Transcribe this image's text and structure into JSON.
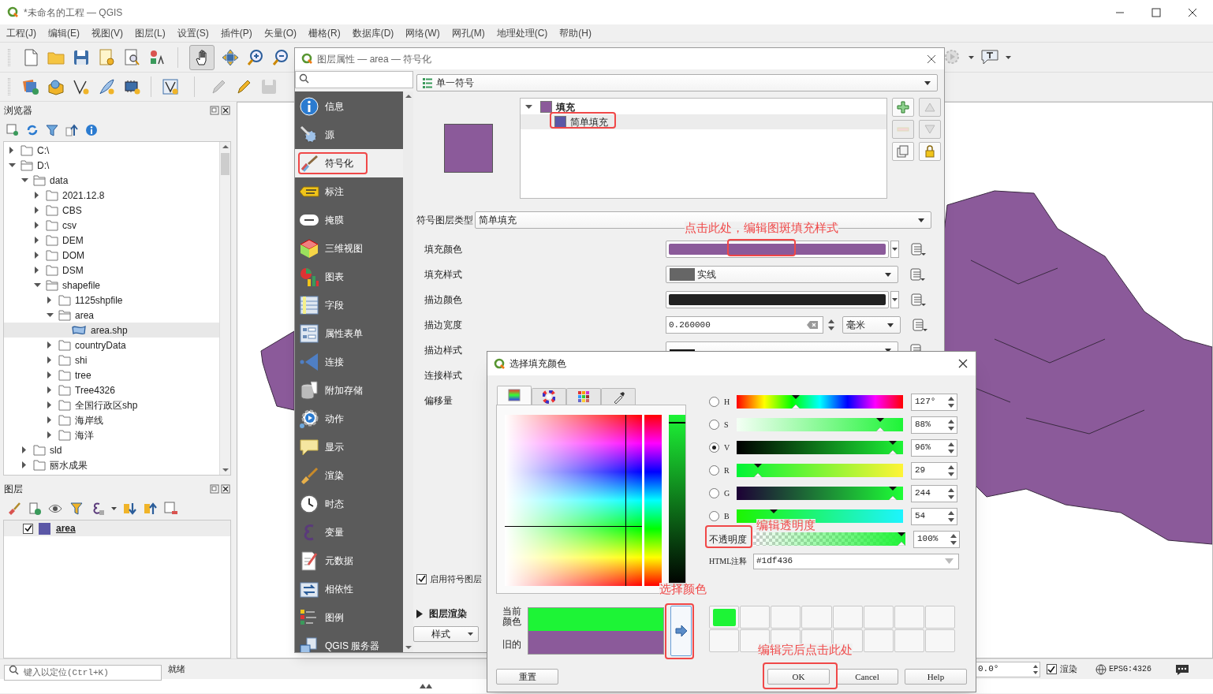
{
  "window": {
    "title": "*未命名的工程 — QGIS"
  },
  "menu": [
    "工程(J)",
    "编辑(E)",
    "视图(V)",
    "图层(L)",
    "设置(S)",
    "插件(P)",
    "矢量(O)",
    "栅格(R)",
    "数据库(D)",
    "网络(W)",
    "网孔(M)",
    "地理处理(C)",
    "帮助(H)"
  ],
  "browser": {
    "title": "浏览器",
    "tree": [
      {
        "label": "C:\\",
        "kind": "folder",
        "expanded": false,
        "selected": false
      },
      {
        "label": "D:\\",
        "kind": "folder",
        "expanded": true,
        "selected": false,
        "children": [
          {
            "label": "data",
            "kind": "folder",
            "expanded": true,
            "selected": false,
            "children": [
              {
                "label": "2021.12.8",
                "kind": "folder",
                "expanded": false,
                "selected": false
              },
              {
                "label": "CBS",
                "kind": "folder",
                "expanded": false,
                "selected": false
              },
              {
                "label": "csv",
                "kind": "folder",
                "expanded": false,
                "selected": false
              },
              {
                "label": "DEM",
                "kind": "folder",
                "expanded": false,
                "selected": false
              },
              {
                "label": "DOM",
                "kind": "folder",
                "expanded": false,
                "selected": false
              },
              {
                "label": "DSM",
                "kind": "folder",
                "expanded": false,
                "selected": false
              },
              {
                "label": "shapefile",
                "kind": "folder",
                "expanded": true,
                "selected": false,
                "children": [
                  {
                    "label": "1125shpfile",
                    "kind": "folder",
                    "expanded": false,
                    "selected": false
                  },
                  {
                    "label": "area",
                    "kind": "folder",
                    "expanded": true,
                    "selected": false,
                    "children": [
                      {
                        "label": "area.shp",
                        "kind": "layer",
                        "selected": true
                      }
                    ]
                  },
                  {
                    "label": "countryData",
                    "kind": "folder",
                    "expanded": false,
                    "selected": false
                  },
                  {
                    "label": "shi",
                    "kind": "folder",
                    "expanded": false,
                    "selected": false
                  },
                  {
                    "label": "tree",
                    "kind": "folder",
                    "expanded": false,
                    "selected": false
                  },
                  {
                    "label": "Tree4326",
                    "kind": "folder",
                    "expanded": false,
                    "selected": false
                  },
                  {
                    "label": "全国行政区shp",
                    "kind": "folder",
                    "expanded": false,
                    "selected": false
                  },
                  {
                    "label": "海岸线",
                    "kind": "folder",
                    "expanded": false,
                    "selected": false
                  },
                  {
                    "label": "海洋",
                    "kind": "folder",
                    "expanded": false,
                    "selected": false
                  }
                ]
              }
            ]
          },
          {
            "label": "sld",
            "kind": "folder",
            "expanded": false,
            "selected": false
          },
          {
            "label": "丽水成果",
            "kind": "folder",
            "expanded": false,
            "selected": false
          }
        ]
      }
    ]
  },
  "layers_panel": {
    "title": "图层",
    "layers": [
      {
        "name": "area",
        "checked": true,
        "selected": true,
        "color": "#5b57a6"
      }
    ]
  },
  "status_bar": {
    "locator_placeholder": "键入以定位(Ctrl+K)",
    "message": "就绪",
    "rotation": "0.0°",
    "render": {
      "label": "渲染",
      "checked": true
    },
    "crs": "EPSG:4326"
  },
  "layer_properties": {
    "title": "图层属性 — area — 符号化",
    "nav": [
      {
        "label": "信息",
        "selected": false
      },
      {
        "label": "源",
        "selected": false
      },
      {
        "label": "符号化",
        "selected": true
      },
      {
        "label": "标注",
        "selected": false
      },
      {
        "label": "掩膜",
        "selected": false
      },
      {
        "label": "三维视图",
        "selected": false
      },
      {
        "label": "图表",
        "selected": false
      },
      {
        "label": "字段",
        "selected": false
      },
      {
        "label": "属性表单",
        "selected": false
      },
      {
        "label": "连接",
        "selected": false
      },
      {
        "label": "附加存储",
        "selected": false
      },
      {
        "label": "动作",
        "selected": false
      },
      {
        "label": "显示",
        "selected": false
      },
      {
        "label": "渲染",
        "selected": false
      },
      {
        "label": "时态",
        "selected": false
      },
      {
        "label": "变量",
        "selected": false
      },
      {
        "label": "元数据",
        "selected": false
      },
      {
        "label": "相依性",
        "selected": false
      },
      {
        "label": "图例",
        "selected": false
      },
      {
        "label": "QGIS 服务器",
        "selected": false
      }
    ],
    "renderer": "单一符号",
    "symbol_tree": [
      {
        "label": "填充",
        "color": "#8b5a9a",
        "expanded": true,
        "selected": false,
        "children": [
          {
            "label": "简单填充",
            "color": "#5b57a6",
            "selected": true
          }
        ]
      }
    ],
    "symbol_layer_type_label": "符号图层类型",
    "symbol_layer_type": "简单填充",
    "properties": [
      {
        "label": "填充颜色",
        "kind": "color",
        "color": "#8b5a9a"
      },
      {
        "label": "填充样式",
        "kind": "fill_style",
        "value": "实线"
      },
      {
        "label": "描边颜色",
        "kind": "color",
        "color": "#222222"
      },
      {
        "label": "描边宽度",
        "kind": "number",
        "value": "0.260000",
        "unit": "毫米"
      },
      {
        "label": "描边样式",
        "kind": "line_style"
      },
      {
        "label": "连接样式",
        "kind": "label_only"
      },
      {
        "label": "偏移量",
        "kind": "label_only"
      }
    ],
    "enable_symbol_layer": {
      "label": "启用符号图层",
      "checked": true
    },
    "layer_rendering": "图层渲染",
    "style_button": "样式"
  },
  "color_dialog": {
    "title": "选择填充颜色",
    "tabs": [
      {
        "selected": true
      },
      {
        "selected": false
      },
      {
        "selected": false
      },
      {
        "selected": false
      }
    ],
    "channels": [
      {
        "label": "H",
        "kind": "hue",
        "selected": false,
        "level": 0.35,
        "value": "127°"
      },
      {
        "label": "S",
        "kind": "saturation",
        "selected": false,
        "level": 0.88,
        "value": "88%"
      },
      {
        "label": "V",
        "kind": "value",
        "selected": true,
        "level": 0.96,
        "value": "96%"
      },
      {
        "label": "R",
        "kind": "red",
        "selected": false,
        "level": 0.11,
        "value": "29"
      },
      {
        "label": "G",
        "kind": "green",
        "selected": false,
        "level": 0.96,
        "value": "244"
      },
      {
        "label": "B",
        "kind": "blue",
        "selected": false,
        "level": 0.21,
        "value": "54"
      }
    ],
    "opacity": {
      "label": "不透明度",
      "level": 1,
      "value": "100%"
    },
    "html": {
      "label": "HTML注释",
      "value": "#1df436"
    },
    "compare": [
      {
        "label": "当前颜色",
        "color": "#1df436"
      },
      {
        "label": "旧的",
        "color": "#8b5a9a"
      }
    ],
    "swatches": [
      {
        "color": "#1df436"
      }
    ],
    "buttons": [
      "重置",
      "OK",
      "Cancel",
      "Help"
    ]
  },
  "annotations": [
    {
      "kind": "frame"
    },
    {
      "kind": "frame"
    },
    {
      "kind": "note",
      "text": "点击此处，编辑图斑填充样式"
    },
    {
      "kind": "frame"
    },
    {
      "kind": "note",
      "text": "编辑透明度"
    },
    {
      "kind": "frame"
    },
    {
      "kind": "note",
      "text": "选择颜色"
    },
    {
      "kind": "frame"
    },
    {
      "kind": "note",
      "text": "编辑完后点击此处"
    },
    {
      "kind": "frame"
    }
  ]
}
